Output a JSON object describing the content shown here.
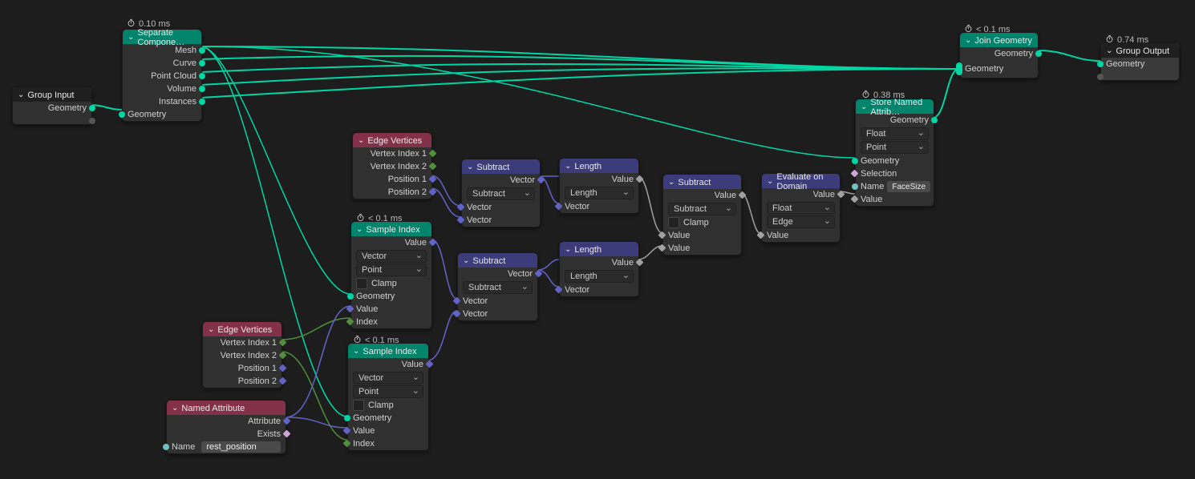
{
  "nodes": {
    "group_input": {
      "title": "Group Input",
      "outputs": [
        "Geometry"
      ]
    },
    "separate": {
      "timing": "0.10 ms",
      "title": "Separate Compone…",
      "outputs": [
        "Mesh",
        "Curve",
        "Point Cloud",
        "Volume",
        "Instances"
      ],
      "inputs": [
        "Geometry"
      ]
    },
    "edge_vertices_1": {
      "title": "Edge Vertices",
      "outputs": [
        "Vertex Index 1",
        "Vertex Index 2",
        "Position 1",
        "Position 2"
      ]
    },
    "edge_vertices_2": {
      "title": "Edge Vertices",
      "outputs": [
        "Vertex Index 1",
        "Vertex Index 2",
        "Position 1",
        "Position 2"
      ]
    },
    "named_attr": {
      "title": "Named Attribute",
      "outputs": [
        "Attribute",
        "Exists"
      ],
      "field_label": "Name",
      "field_value": "rest_position"
    },
    "sample_index_1": {
      "timing": "< 0.1 ms",
      "title": "Sample Index",
      "outputs": [
        "Value"
      ],
      "dropdown1": "Vector",
      "dropdown2": "Point",
      "clamp": "Clamp",
      "inputs": [
        "Geometry",
        "Value",
        "Index"
      ]
    },
    "sample_index_2": {
      "timing": "< 0.1 ms",
      "title": "Sample Index",
      "outputs": [
        "Value"
      ],
      "dropdown1": "Vector",
      "dropdown2": "Point",
      "clamp": "Clamp",
      "inputs": [
        "Geometry",
        "Value",
        "Index"
      ]
    },
    "subtract_1": {
      "title": "Subtract",
      "outputs": [
        "Vector"
      ],
      "dropdown": "Subtract",
      "inputs": [
        "Vector",
        "Vector"
      ]
    },
    "subtract_2": {
      "title": "Subtract",
      "outputs": [
        "Vector"
      ],
      "dropdown": "Subtract",
      "inputs": [
        "Vector",
        "Vector"
      ]
    },
    "length_1": {
      "title": "Length",
      "outputs": [
        "Value"
      ],
      "dropdown": "Length",
      "inputs": [
        "Vector"
      ]
    },
    "length_2": {
      "title": "Length",
      "outputs": [
        "Value"
      ],
      "dropdown": "Length",
      "inputs": [
        "Vector"
      ]
    },
    "subtract_float": {
      "title": "Subtract",
      "outputs": [
        "Value"
      ],
      "dropdown": "Subtract",
      "clamp": "Clamp",
      "inputs": [
        "Value",
        "Value"
      ]
    },
    "eval_domain": {
      "title": "Evaluate on Domain",
      "outputs": [
        "Value"
      ],
      "dropdown1": "Float",
      "dropdown2": "Edge",
      "inputs": [
        "Value"
      ]
    },
    "store_named": {
      "timing": "0.38 ms",
      "title": "Store Named Attrib…",
      "outputs": [
        "Geometry"
      ],
      "dropdown1": "Float",
      "dropdown2": "Point",
      "inputs": [
        "Geometry",
        "Selection",
        "Name",
        "Value"
      ],
      "name_value": "FaceSize"
    },
    "join_geom": {
      "timing": "< 0.1 ms",
      "title": "Join Geometry",
      "outputs": [
        "Geometry"
      ],
      "inputs": [
        "Geometry"
      ]
    },
    "group_output": {
      "timing": "0.74 ms",
      "title": "Group Output",
      "inputs": [
        "Geometry"
      ]
    }
  }
}
